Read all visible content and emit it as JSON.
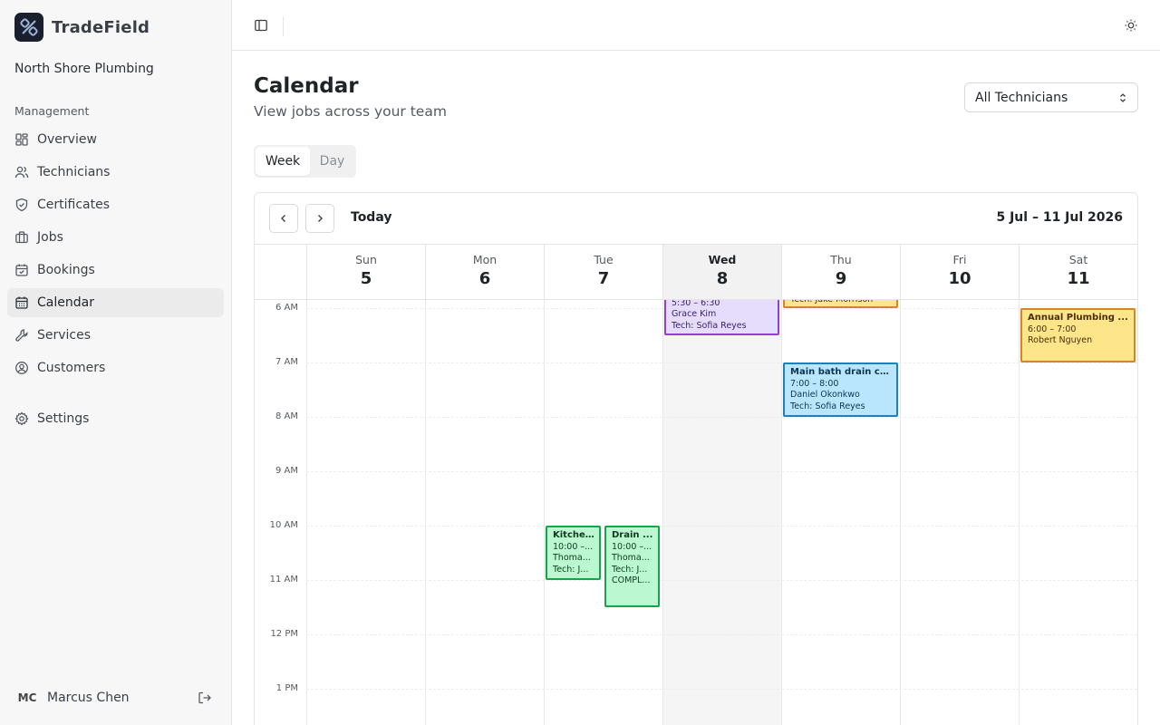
{
  "brand": {
    "name": "TradeField"
  },
  "org": {
    "name": "North Shore Plumbing"
  },
  "sidebar": {
    "section_label": "Management",
    "items": [
      {
        "label": "Overview",
        "icon": "grid-icon"
      },
      {
        "label": "Technicians",
        "icon": "users-icon"
      },
      {
        "label": "Certificates",
        "icon": "shield-check-icon"
      },
      {
        "label": "Jobs",
        "icon": "briefcase-icon"
      },
      {
        "label": "Bookings",
        "icon": "calendar-check-icon"
      },
      {
        "label": "Calendar",
        "icon": "calendar-icon",
        "active": true
      },
      {
        "label": "Services",
        "icon": "wrench-icon"
      },
      {
        "label": "Customers",
        "icon": "user-circle-icon"
      }
    ],
    "settings_label": "Settings"
  },
  "user": {
    "initials": "MC",
    "name": "Marcus Chen"
  },
  "header": {
    "title": "Calendar",
    "subtitle": "View jobs across your team",
    "technician_filter": "All Technicians"
  },
  "view_tabs": {
    "week": "Week",
    "day": "Day",
    "selected": "Week"
  },
  "calendar": {
    "today_label": "Today",
    "date_range": "5 Jul – 11 Jul 2026",
    "days": [
      {
        "name": "Sun",
        "num": "5"
      },
      {
        "name": "Mon",
        "num": "6"
      },
      {
        "name": "Tue",
        "num": "7"
      },
      {
        "name": "Wed",
        "num": "8",
        "today": true
      },
      {
        "name": "Thu",
        "num": "9"
      },
      {
        "name": "Fri",
        "num": "10"
      },
      {
        "name": "Sat",
        "num": "11"
      }
    ],
    "hours": [
      "6 AM",
      "7 AM",
      "8 AM",
      "9 AM",
      "10 AM",
      "11 AM",
      "12 PM",
      "1 PM"
    ],
    "events": [
      {
        "id": "ev-wed-530",
        "title": "",
        "lines": [
          "5:30 – 6:30",
          "Grace Kim",
          "Tech: Sofia Reyes"
        ],
        "color": "purple"
      },
      {
        "id": "ev-thu-early",
        "title": "",
        "lines": [
          "Tech: Jake Morrison"
        ],
        "color": "yellow"
      },
      {
        "id": "ev-sat-600",
        "title": "Annual Plumbing ...",
        "lines": [
          "6:00 – 7:00",
          "Robert Nguyen"
        ],
        "color": "yellow"
      },
      {
        "id": "ev-thu-700",
        "title": "Main bath drain cl...",
        "lines": [
          "7:00 – 8:00",
          "Daniel Okonkwo",
          "Tech: Sofia Reyes"
        ],
        "color": "blue"
      },
      {
        "id": "ev-tue-kitchen",
        "title": "Kitche...",
        "lines": [
          "10:00 –...",
          "Thoma...",
          "Tech: J..."
        ],
        "color": "green"
      },
      {
        "id": "ev-tue-drain",
        "title": "Drain ...",
        "lines": [
          "10:00 –...",
          "Thoma...",
          "Tech: J...",
          "COMPL..."
        ],
        "color": "green"
      }
    ]
  },
  "colors": {
    "purple": {
      "bg": "#e6dcfb",
      "border": "#8f3fd8",
      "text": "#3b1d6e"
    },
    "yellow": {
      "bg": "#fde68a",
      "border": "#d9822b",
      "text": "#4a2e05"
    },
    "blue": {
      "bg": "#bae6fd",
      "border": "#1f7fb8",
      "text": "#0c3553"
    },
    "green": {
      "bg": "#bbf7d0",
      "border": "#16a34a",
      "text": "#0d3b20"
    }
  }
}
